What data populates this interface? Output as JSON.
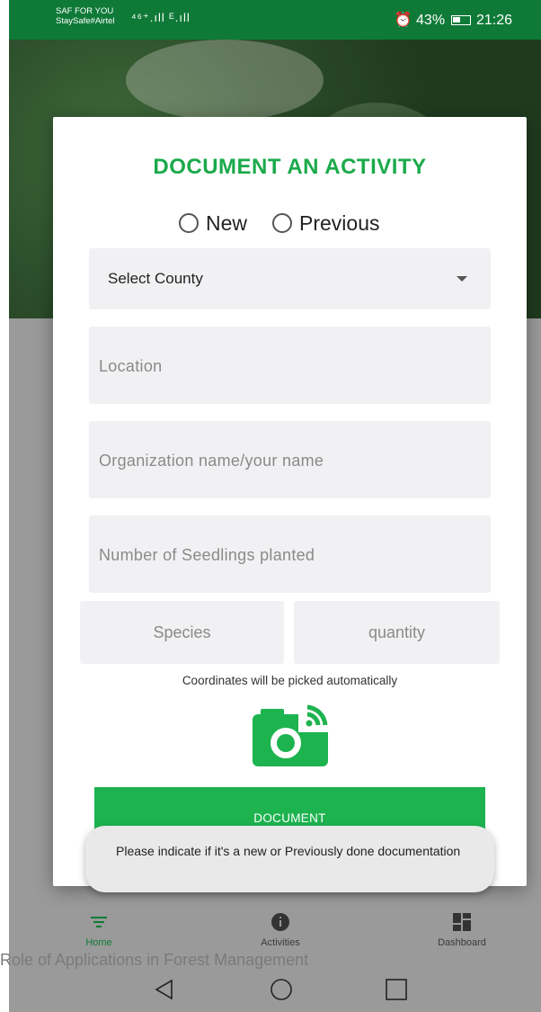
{
  "status_bar": {
    "carrier_line1": "SAF FOR YOU",
    "carrier_line2": "StaySafe#Airtel",
    "signal_text": "⁴⁶⁺.ıll ᴱ.ıll",
    "battery_percent": "43%",
    "time": "21:26"
  },
  "dialog": {
    "title": "DOCUMENT AN ACTIVITY",
    "radio_new": "New",
    "radio_previous": "Previous",
    "county_select": "Select County",
    "location_placeholder": "Location",
    "organization_placeholder": "Organization name/your name",
    "seedlings_placeholder": "Number of Seedlings planted",
    "species_placeholder": "Species",
    "quantity_placeholder": "quantity",
    "coordinates_note": "Coordinates will be picked automatically",
    "document_button": "DOCUMENT"
  },
  "toast": {
    "message": "Please indicate if it's a new or Previously done documentation"
  },
  "bottom_nav": {
    "home": "Home",
    "activities": "Activities",
    "dashboard": "Dashboard"
  },
  "caption": "Role of Applications in Forest Management",
  "colors": {
    "brand_green": "#1aaa4a",
    "status_green": "#0f7a38",
    "button_green": "#1db34f"
  }
}
